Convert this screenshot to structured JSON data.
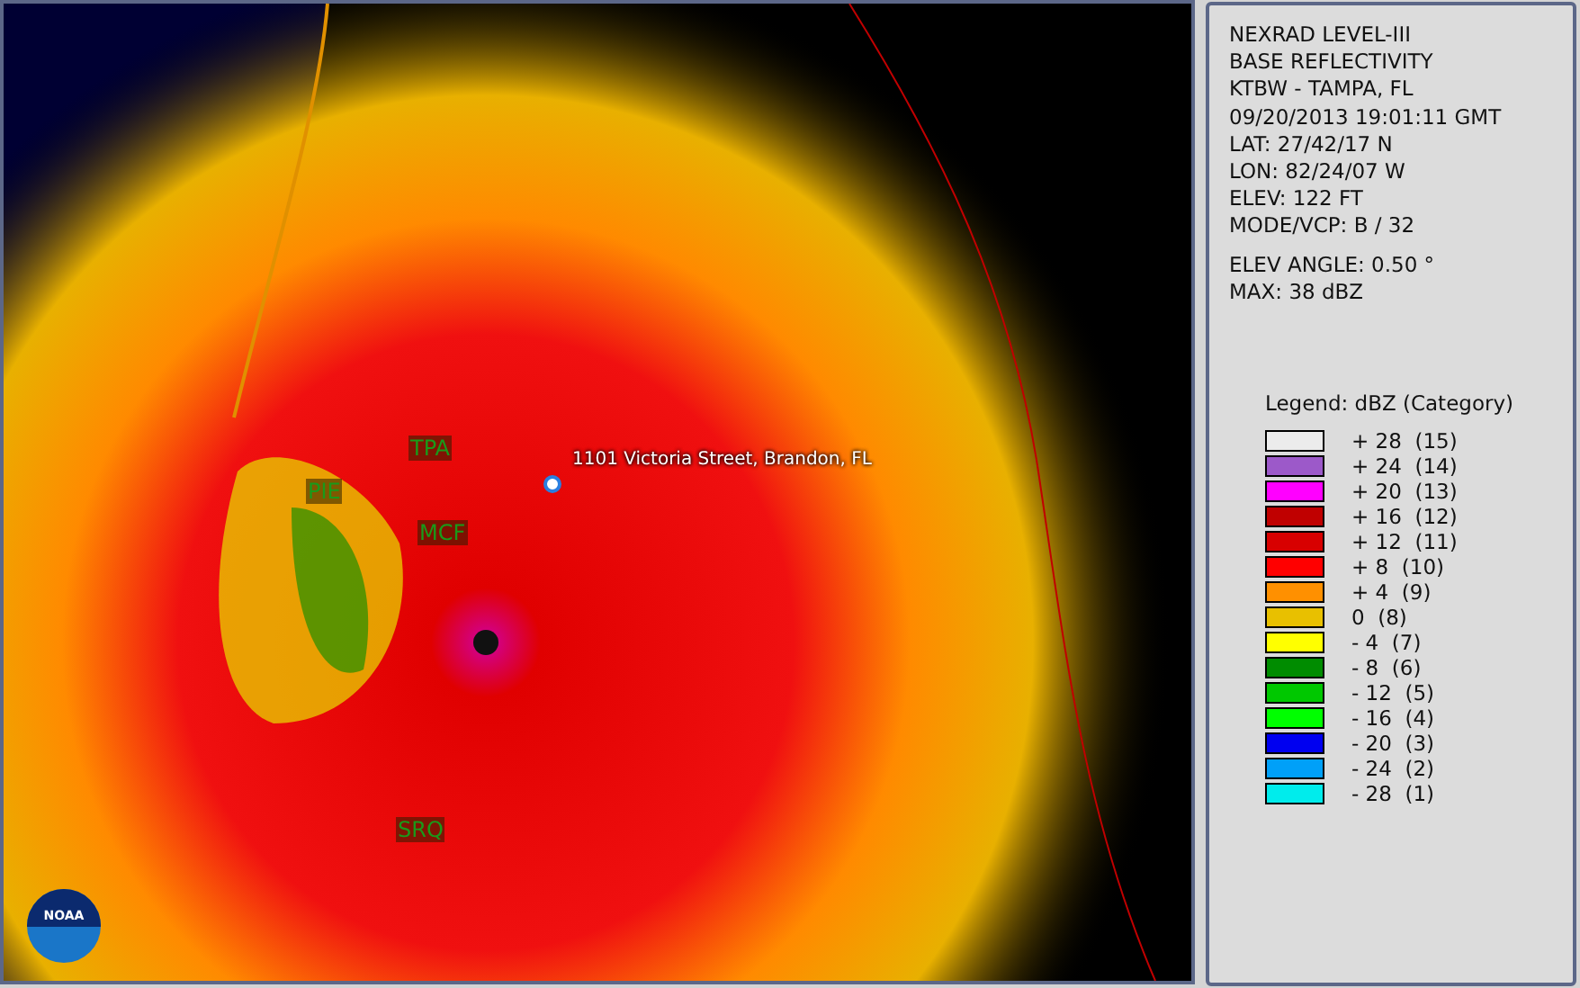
{
  "map": {
    "stations": [
      {
        "code": "TPA"
      },
      {
        "code": "PIE"
      },
      {
        "code": "MCF"
      },
      {
        "code": "SRQ"
      }
    ],
    "location": {
      "label": "1101 Victoria Street, Brandon, FL"
    },
    "logo_text": "NOAA"
  },
  "info": {
    "lines": [
      "NEXRAD LEVEL-III",
      "BASE REFLECTIVITY",
      "KTBW - TAMPA, FL",
      "09/20/2013 19:01:11 GMT",
      "LAT: 27/42/17 N",
      "LON: 82/24/07 W",
      "ELEV: 122 FT",
      "MODE/VCP: B / 32"
    ],
    "extra_lines": [
      "ELEV ANGLE: 0.50 °",
      "MAX: 38 dBZ"
    ]
  },
  "legend": {
    "title": "Legend: dBZ (Category)",
    "items": [
      {
        "label": "+ 28  (15)",
        "color": "#ececec"
      },
      {
        "label": "+ 24  (14)",
        "color": "#9c59c9"
      },
      {
        "label": "+ 20  (13)",
        "color": "#ff00ff"
      },
      {
        "label": "+ 16  (12)",
        "color": "#c00000"
      },
      {
        "label": "+ 12  (11)",
        "color": "#d80000"
      },
      {
        "label": "+ 8  (10)",
        "color": "#ff0000"
      },
      {
        "label": "+ 4  (9)",
        "color": "#ff9000"
      },
      {
        "label": "0  (8)",
        "color": "#e8c000"
      },
      {
        "label": "- 4  (7)",
        "color": "#ffff00"
      },
      {
        "label": "- 8  (6)",
        "color": "#008c00"
      },
      {
        "label": "- 12  (5)",
        "color": "#00c800"
      },
      {
        "label": "- 16  (4)",
        "color": "#00ff00"
      },
      {
        "label": "- 20  (3)",
        "color": "#0000f0"
      },
      {
        "label": "- 24  (2)",
        "color": "#00a0f8"
      },
      {
        "label": "- 28  (1)",
        "color": "#00ecec"
      }
    ]
  }
}
